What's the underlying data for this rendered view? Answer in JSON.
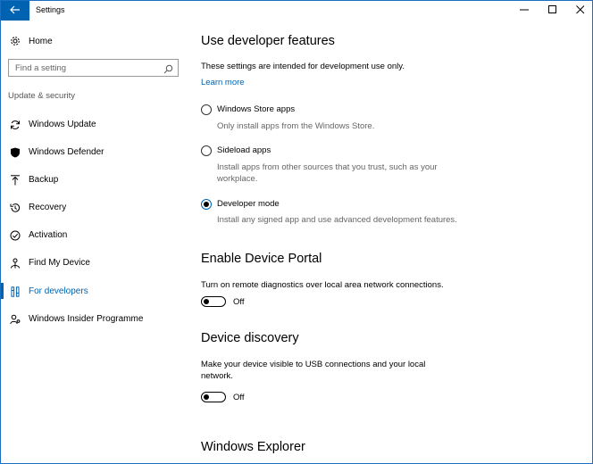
{
  "window": {
    "title": "Settings",
    "accent_color": "#0063b1"
  },
  "sidebar": {
    "home_label": "Home",
    "search_placeholder": "Find a setting",
    "section_label": "Update & security",
    "items": [
      {
        "label": "Windows Update",
        "icon": "sync-icon",
        "active": false
      },
      {
        "label": "Windows Defender",
        "icon": "shield-icon",
        "active": false
      },
      {
        "label": "Backup",
        "icon": "upload-arrow-icon",
        "active": false
      },
      {
        "label": "Recovery",
        "icon": "history-icon",
        "active": false
      },
      {
        "label": "Activation",
        "icon": "checkmark-circle-icon",
        "active": false
      },
      {
        "label": "Find My Device",
        "icon": "person-pin-icon",
        "active": false
      },
      {
        "label": "For developers",
        "icon": "developer-tools-icon",
        "active": true
      },
      {
        "label": "Windows Insider Programme",
        "icon": "insider-person-icon",
        "active": false
      }
    ]
  },
  "developer_features": {
    "heading": "Use developer features",
    "description": "These settings are intended for development use only.",
    "learn_more": "Learn more",
    "options": [
      {
        "label": "Windows Store apps",
        "description_lines": [
          "Only install apps from the Windows Store."
        ],
        "selected": false
      },
      {
        "label": "Sideload apps",
        "description_lines": [
          "Install apps from other sources that you trust, such as your",
          "workplace."
        ],
        "selected": false
      },
      {
        "label": "Developer mode",
        "description_lines": [
          "Install any signed app and use advanced development features."
        ],
        "selected": true
      }
    ]
  },
  "device_portal": {
    "heading": "Enable Device Portal",
    "description": "Turn on remote diagnostics over local area network connections.",
    "toggle_state": "Off"
  },
  "device_discovery": {
    "heading": "Device discovery",
    "description_lines": [
      "Make your device visible to USB connections and your local",
      "network."
    ],
    "toggle_state": "Off"
  },
  "windows_explorer": {
    "heading": "Windows Explorer"
  }
}
